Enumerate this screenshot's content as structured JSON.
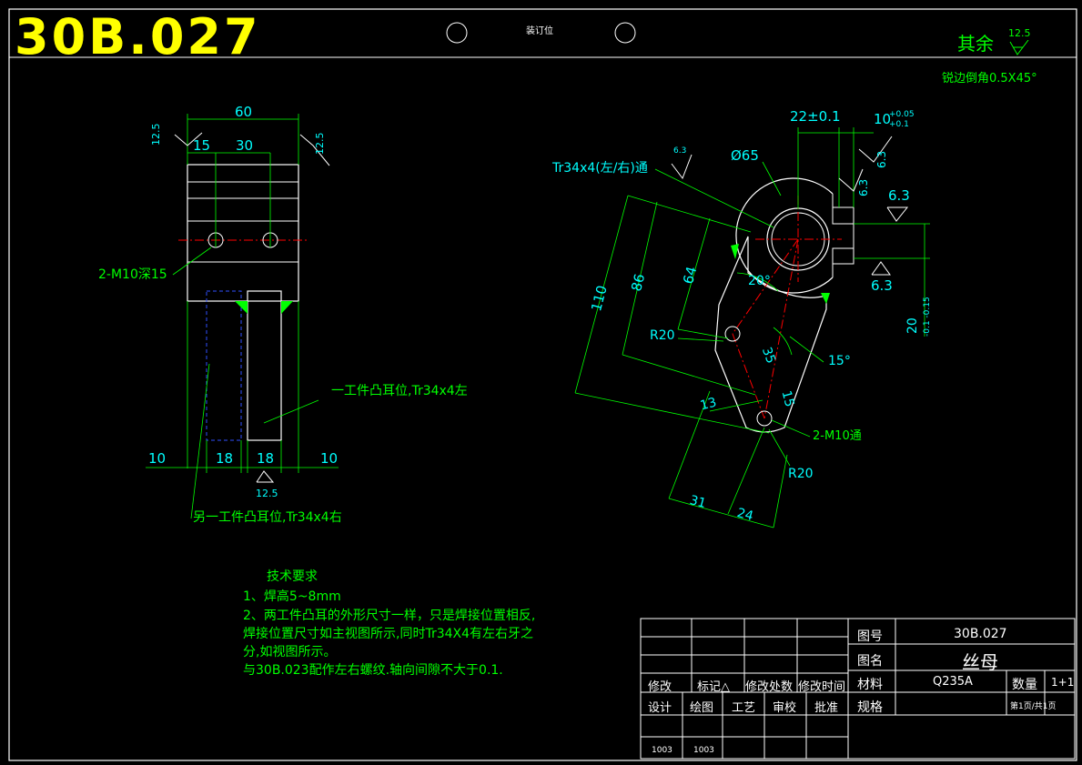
{
  "title": {
    "drawing_no": "30B.027",
    "binding_label": "装订位",
    "roughness_other_label": "其余",
    "roughness_other_value": "12.5",
    "edge_note": "锐边倒角0.5X45°"
  },
  "front_view": {
    "dims": {
      "d60": "60",
      "d15": "15",
      "d30": "30",
      "d10_left": "10",
      "d18_left": "18",
      "d18_right": "18",
      "d10_right": "10",
      "rough_left": "12.5",
      "rough_right": "12.5",
      "rough_bottom": "12.5"
    },
    "labels": {
      "holes": "2-M10深15",
      "lug_a": "一工件凸耳位,Tr34x4左",
      "lug_b": "另一工件凸耳位,Tr34x4右"
    }
  },
  "side_view": {
    "dims": {
      "d22": "22±0.1",
      "d10": "10",
      "d10_tol_up": "+0.05",
      "d10_tol_low": "+0.1",
      "d65": "Ø65",
      "thread": "Tr34x4(左/右)通",
      "thread_rough": "6.3",
      "r63a": "6.3",
      "r63b": "6.3",
      "r63c": "6.3",
      "r63d": "6.3",
      "d110": "110",
      "d86": "86",
      "d64": "64",
      "ang20": "20°",
      "r20a": "R20",
      "d35": "35",
      "ang15": "15°",
      "d13": "13",
      "d15": "15",
      "holes": "2-M10通",
      "r20b": "R20",
      "d31": "31",
      "d24": "24",
      "d20": "20",
      "d20_tol": "-0.1 -0.15"
    }
  },
  "tech_requirements": {
    "heading": "技术要求",
    "lines": [
      "1、焊高5~8mm",
      "2、两工件凸耳的外形尺寸一样，只是焊接位置相反,",
      "焊接位置尺寸如主视图所示,同时Tr34X4有左右牙之",
      "分,如视图所示。",
      "与30B.023配作左右螺纹.轴向间隙不大于0.1."
    ]
  },
  "title_block": {
    "drawing_no_label": "图号",
    "drawing_no_value": "30B.027",
    "name_label": "图名",
    "name_value": "丝母",
    "material_label": "材料",
    "material_value": "Q235A",
    "qty_label": "数量",
    "qty_value": "1+1",
    "spec_label": "规格",
    "page_info": "第1页/共1页",
    "rev_labels": [
      "修改",
      "标记△",
      "修改处数",
      "修改时间"
    ],
    "role_labels": [
      "设计",
      "绘图",
      "工艺",
      "审校",
      "批准"
    ],
    "dates": [
      "1003",
      "1003"
    ]
  }
}
